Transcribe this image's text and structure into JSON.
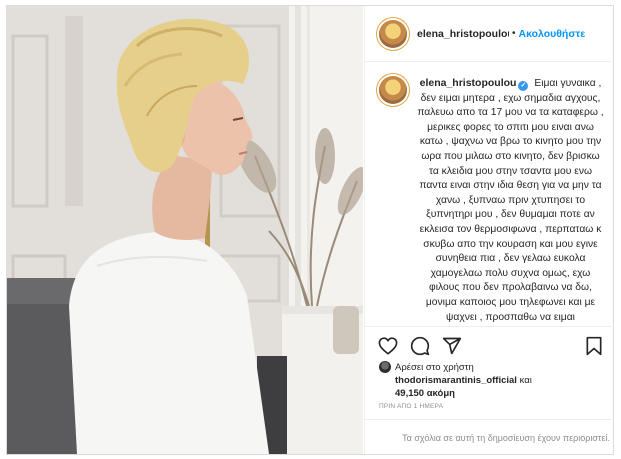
{
  "post": {
    "username": "elena_hristopoulou",
    "header_username": "elena_hristopoulou",
    "separator": "•",
    "follow_label": "Ακολουθήστε",
    "caption": "Ειμαι γυναικα , δεν ειμαι μητερα , εχω σημαδια αγχους, παλευω απο τα 17 μου να τα καταφερω , μερικες φορες το σπιτι μου ειναι ανω κατω , ψαχνω να βρω το κινητο μου την ωρα που μιλαω στο κινητο, δεν βρισκω τα κλειδια μου στην τσαντα μου ενω παντα ειναι στην ιδια θεση για να μην τα χανω , ξυπναω πριν χτυπησει το ξυπνητηρι μου , δεν θυμαμαι ποτε αν εκλεισα τον θερμοσιφωνα , περπαταω κ σκυβω απο την κουραση και μου εγινε συνηθεια πια , δεν γελαω ευκολα χαμογελαω πολυ συχνα ομως, εχω φιλους που δεν προλαβαινω να δω, μονιμα καποιος μου τηλεφωνει και με ψαχνει , προσπαθω να ειμαι"
  },
  "icons": {
    "like": "heart-icon",
    "comment": "comment-icon",
    "share": "share-icon",
    "save": "bookmark-icon",
    "verified": "verified-badge-icon",
    "verified_glyph": "✓"
  },
  "likes": {
    "prefix": "Αρέσει στο χρήστη",
    "user": "thodorismarantinis_official",
    "conjunction": "και",
    "count": "49,150",
    "suffix": "ακόμη"
  },
  "timestamp": "ΠΡΙΝ ΑΠΟ 1 ΗΜΕΡΑ",
  "comments_notice": "Τα σχόλια σε αυτή τη δημοσίευση έχουν περιοριστεί.",
  "colors": {
    "accent": "#0095f6",
    "verified": "#3897f0",
    "muted": "#8e8e8e",
    "text": "#262626"
  }
}
